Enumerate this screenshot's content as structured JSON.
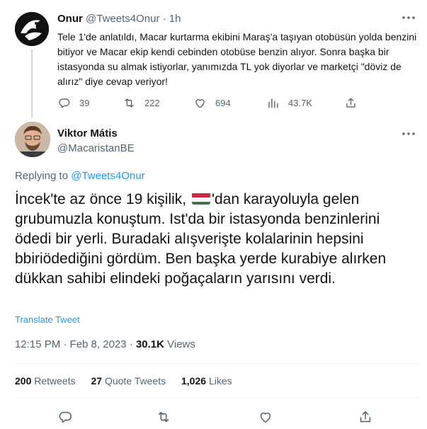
{
  "tweet1": {
    "name": "Onur",
    "handle": "@Tweets4Onur",
    "time": "1h",
    "text": "Tele 1'de anlatıldı, Macar kurtarma ekibini Maraş'a taşıyan otobüsün yolda benzini bitiyor ve Macar ekip kendi cebinden otobüse benzin alıyor. Sonra başka bir istasyonda su almak istiyorlar, yanımızda TL yok diyorlar ve marketçi \"döviz de alırız\" diye cevap veriyor!",
    "replies": "39",
    "retweets": "222",
    "likes": "694",
    "views": "43.7K"
  },
  "tweet2": {
    "name": "Viktor Mátis",
    "handle": "@MacaristanBE",
    "replying_prefix": "Replying to",
    "replying_to": "@Tweets4Onur",
    "text_before_flag": "İncek'te az önce 19 kişilik,",
    "text_after_flag": "'dan karayoluyla gelen grubumuzla konuştum. Ist'da bir istasyonda benzinlerini ödedi bir yerli. Buradaki alışverişte kolalarinin hepsini bbiriödediğini gördüm. Ben başka yerde kurabiye alırken dükkan sahibi elindeki poğaçaların yarısını verdi.",
    "translate": "Translate Tweet",
    "time": "12:15 PM · Feb 8, 2023 ·",
    "views_count": "30.1K",
    "views_label": "Views",
    "retweets_count": "200",
    "retweets_label": "Retweets",
    "quotes_count": "27",
    "quotes_label": "Quote Tweets",
    "likes_count": "1,026",
    "likes_label": "Likes"
  },
  "icons": {
    "reply": "reply-icon",
    "retweet": "retweet-icon",
    "like": "heart-icon",
    "views": "analytics-icon",
    "share": "share-icon",
    "more": "more-icon",
    "flag": "hungary-flag-icon"
  },
  "colors": {
    "link": "#1d9bf0",
    "secondary_text": "#536471",
    "primary_text": "#0f1419",
    "flag_red": "#cd2a3e",
    "flag_green": "#436f4d"
  }
}
